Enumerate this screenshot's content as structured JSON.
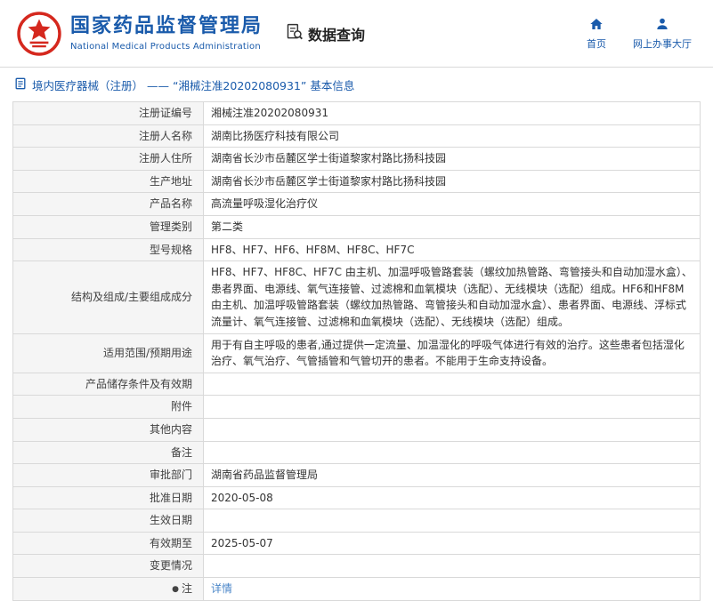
{
  "header": {
    "agency_cn": "国家药品监督管理局",
    "agency_en": "National Medical Products Administration",
    "query_label": "数据查询",
    "home_label": "首页",
    "hall_label": "网上办事大厅"
  },
  "breadcrumb": {
    "text": "境内医疗器械（注册） —— “湘械注准20202080931” 基本信息"
  },
  "colors": {
    "brand_blue": "#1a5bab",
    "emblem_red": "#d5281e",
    "link_blue": "#4a86c8",
    "label_bg": "#f5f5f5",
    "border_gray": "#d9d9d9"
  },
  "table": {
    "rows": [
      {
        "label": "注册证编号",
        "value": "湘械注准20202080931"
      },
      {
        "label": "注册人名称",
        "value": "湖南比扬医疗科技有限公司"
      },
      {
        "label": "注册人住所",
        "value": "湖南省长沙市岳麓区学士街道黎家村路比扬科技园"
      },
      {
        "label": "生产地址",
        "value": "湖南省长沙市岳麓区学士街道黎家村路比扬科技园"
      },
      {
        "label": "产品名称",
        "value": "高流量呼吸湿化治疗仪"
      },
      {
        "label": "管理类别",
        "value": "第二类"
      },
      {
        "label": "型号规格",
        "value": "HF8、HF7、HF6、HF8M、HF8C、HF7C"
      },
      {
        "label": "结构及组成/主要组成成分",
        "value": "HF8、HF7、HF8C、HF7C 由主机、加温呼吸管路套装（螺纹加热管路、弯管接头和自动加湿水盒）、患者界面、电源线、氧气连接管、过滤棉和血氧模块（选配）、无线模块（选配）组成。HF6和HF8M 由主机、加温呼吸管路套装（螺纹加热管路、弯管接头和自动加湿水盒）、患者界面、电源线、浮标式流量计、氧气连接管、过滤棉和血氧模块（选配）、无线模块（选配）组成。"
      },
      {
        "label": "适用范围/预期用途",
        "value": "用于有自主呼吸的患者,通过提供一定流量、加温湿化的呼吸气体进行有效的治疗。这些患者包括湿化治疗、氧气治疗、气管插管和气管切开的患者。不能用于生命支持设备。"
      },
      {
        "label": "产品储存条件及有效期",
        "value": ""
      },
      {
        "label": "附件",
        "value": ""
      },
      {
        "label": "其他内容",
        "value": ""
      },
      {
        "label": "备注",
        "value": ""
      },
      {
        "label": "审批部门",
        "value": "湖南省药品监督管理局"
      },
      {
        "label": "批准日期",
        "value": "2020-05-08"
      },
      {
        "label": "生效日期",
        "value": ""
      },
      {
        "label": "有效期至",
        "value": "2025-05-07"
      },
      {
        "label": "变更情况",
        "value": ""
      },
      {
        "label": "注",
        "label_icon": "note-bullet-icon",
        "value": "详情",
        "value_type": "link"
      }
    ]
  }
}
